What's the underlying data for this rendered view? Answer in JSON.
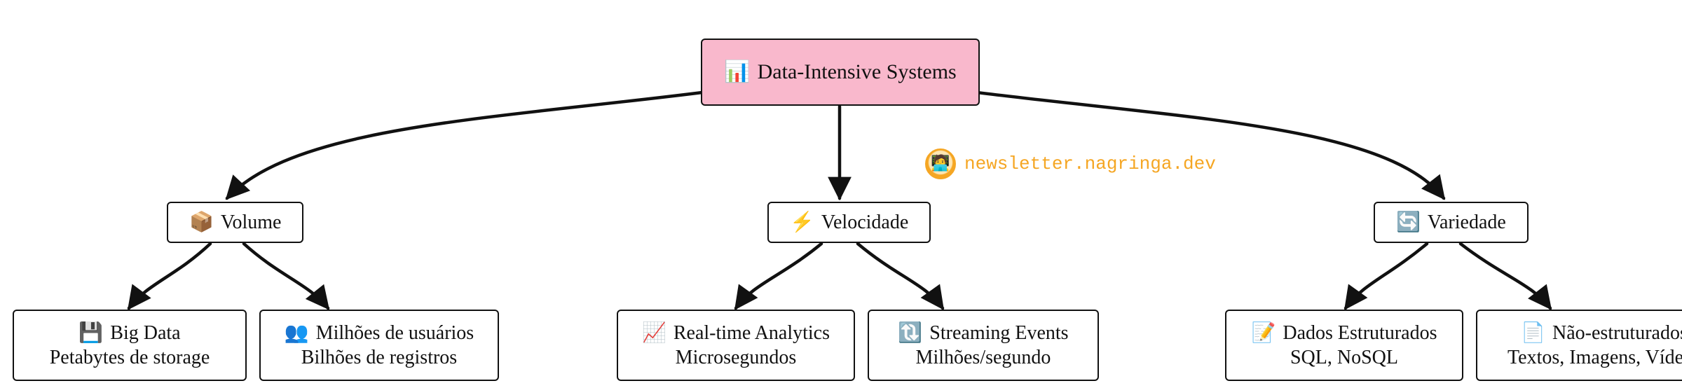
{
  "root": {
    "icon": "📊",
    "label": "Data-Intensive Systems"
  },
  "mids": {
    "volume": {
      "icon": "📦",
      "label": "Volume"
    },
    "velocidade": {
      "icon": "⚡",
      "label": "Velocidade"
    },
    "variedade": {
      "icon": "🔄",
      "label": "Variedade"
    }
  },
  "leaves": {
    "bigdata": {
      "icon": "💾",
      "line1": "Big Data",
      "line2": "Petabytes de storage"
    },
    "users": {
      "icon": "👥",
      "line1": "Milhões de usuários",
      "line2": "Bilhões de registros"
    },
    "realtime": {
      "icon": "📈",
      "line1": "Real-time Analytics",
      "line2": "Microsegundos"
    },
    "streaming": {
      "icon": "🔃",
      "line1": "Streaming Events",
      "line2": "Milhões/segundo"
    },
    "structured": {
      "icon": "📝",
      "line1": "Dados Estruturados",
      "line2": "SQL, NoSQL"
    },
    "unstruct": {
      "icon": "📄",
      "line1": "Não-estruturados",
      "line2": "Textos, Imagens, Vídeos"
    }
  },
  "watermark": {
    "icon": "🧑‍💻",
    "text": "newsletter.nagringa.dev"
  }
}
